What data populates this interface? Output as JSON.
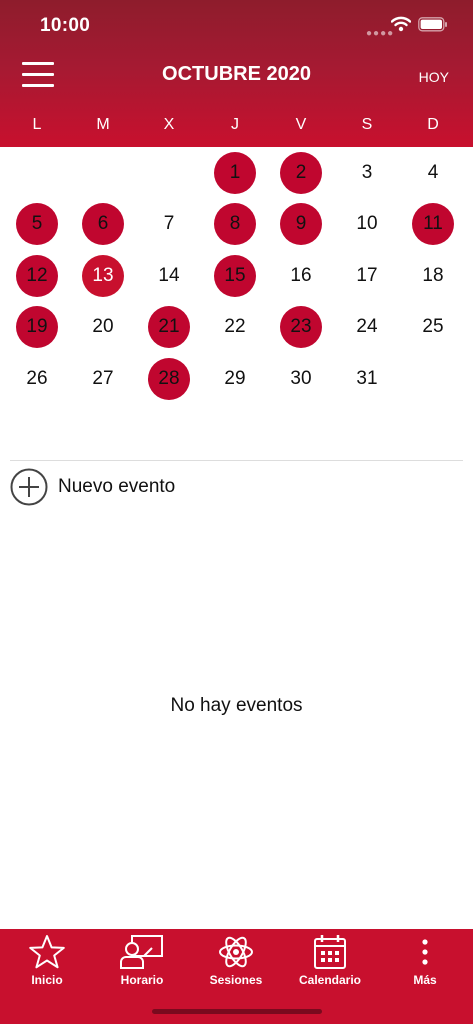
{
  "status_bar": {
    "time": "10:00"
  },
  "header": {
    "title": "OCTUBRE 2020",
    "today_label": "HOY"
  },
  "weekdays": [
    "L",
    "M",
    "X",
    "J",
    "V",
    "S",
    "D"
  ],
  "calendar": {
    "leading_blank_days": 3,
    "days": [
      {
        "day": "1",
        "event": true
      },
      {
        "day": "2",
        "event": true
      },
      {
        "day": "3",
        "event": false
      },
      {
        "day": "4",
        "event": false
      },
      {
        "day": "5",
        "event": true
      },
      {
        "day": "6",
        "event": true
      },
      {
        "day": "7",
        "event": false
      },
      {
        "day": "8",
        "event": true
      },
      {
        "day": "9",
        "event": true
      },
      {
        "day": "10",
        "event": false
      },
      {
        "day": "11",
        "event": true
      },
      {
        "day": "12",
        "event": true
      },
      {
        "day": "13",
        "event": true,
        "selected": true
      },
      {
        "day": "14",
        "event": false
      },
      {
        "day": "15",
        "event": true
      },
      {
        "day": "16",
        "event": false
      },
      {
        "day": "17",
        "event": false
      },
      {
        "day": "18",
        "event": false
      },
      {
        "day": "19",
        "event": true
      },
      {
        "day": "20",
        "event": false
      },
      {
        "day": "21",
        "event": true
      },
      {
        "day": "22",
        "event": false
      },
      {
        "day": "23",
        "event": true
      },
      {
        "day": "24",
        "event": false
      },
      {
        "day": "25",
        "event": false
      },
      {
        "day": "26",
        "event": false
      },
      {
        "day": "27",
        "event": false
      },
      {
        "day": "28",
        "event": true
      },
      {
        "day": "29",
        "event": false
      },
      {
        "day": "30",
        "event": false
      },
      {
        "day": "31",
        "event": false
      }
    ]
  },
  "events_panel": {
    "new_event_label": "Nuevo evento",
    "empty_message": "No hay eventos"
  },
  "tabbar": {
    "items": [
      {
        "label": "Inicio",
        "icon": "star-icon"
      },
      {
        "label": "Horario",
        "icon": "schedule-icon"
      },
      {
        "label": "Sesiones",
        "icon": "atom-icon"
      },
      {
        "label": "Calendario",
        "icon": "calendar-icon"
      },
      {
        "label": "Más",
        "icon": "more-icon"
      }
    ]
  },
  "colors": {
    "brand_red": "#c8102e",
    "header_dark_red": "#8e1c2c",
    "event_red": "#c0062f"
  }
}
